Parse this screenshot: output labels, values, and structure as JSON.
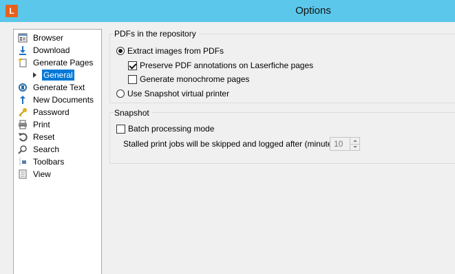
{
  "window": {
    "title": "Options",
    "app_logo_letter": "L",
    "accent_color": "#5bc7ea",
    "logo_color": "#e8601c"
  },
  "tree": {
    "items": [
      {
        "label": "Browser",
        "icon": "browser-icon"
      },
      {
        "label": "Download",
        "icon": "download-arrow-icon"
      },
      {
        "label": "Generate Pages",
        "icon": "generate-pages-icon"
      },
      {
        "label": "General",
        "icon": "expander-arrow-icon",
        "selected": true
      },
      {
        "label": "Generate Text",
        "icon": "generate-text-icon"
      },
      {
        "label": "New Documents",
        "icon": "upload-arrow-icon"
      },
      {
        "label": "Password",
        "icon": "key-icon"
      },
      {
        "label": "Print",
        "icon": "printer-icon"
      },
      {
        "label": "Reset",
        "icon": "reset-icon"
      },
      {
        "label": "Search",
        "icon": "magnifier-icon"
      },
      {
        "label": "Toolbars",
        "icon": "toolbars-icon"
      },
      {
        "label": "View",
        "icon": "view-icon"
      }
    ]
  },
  "pdfs": {
    "title": "PDFs in the repository",
    "extract_label": "Extract images from PDFs",
    "extract_checked": true,
    "preserve_label": "Preserve PDF annotations on Laserfiche pages",
    "preserve_checked": true,
    "monochrome_label": "Generate monochrome pages",
    "monochrome_checked": false,
    "snapshot_printer_label": "Use Snapshot virtual printer",
    "snapshot_printer_checked": false
  },
  "snapshot": {
    "title": "Snapshot",
    "batch_label": "Batch processing mode",
    "batch_checked": false,
    "stalled_label": "Stalled print jobs will be skipped and logged after (minutes)",
    "stalled_value": "10"
  }
}
